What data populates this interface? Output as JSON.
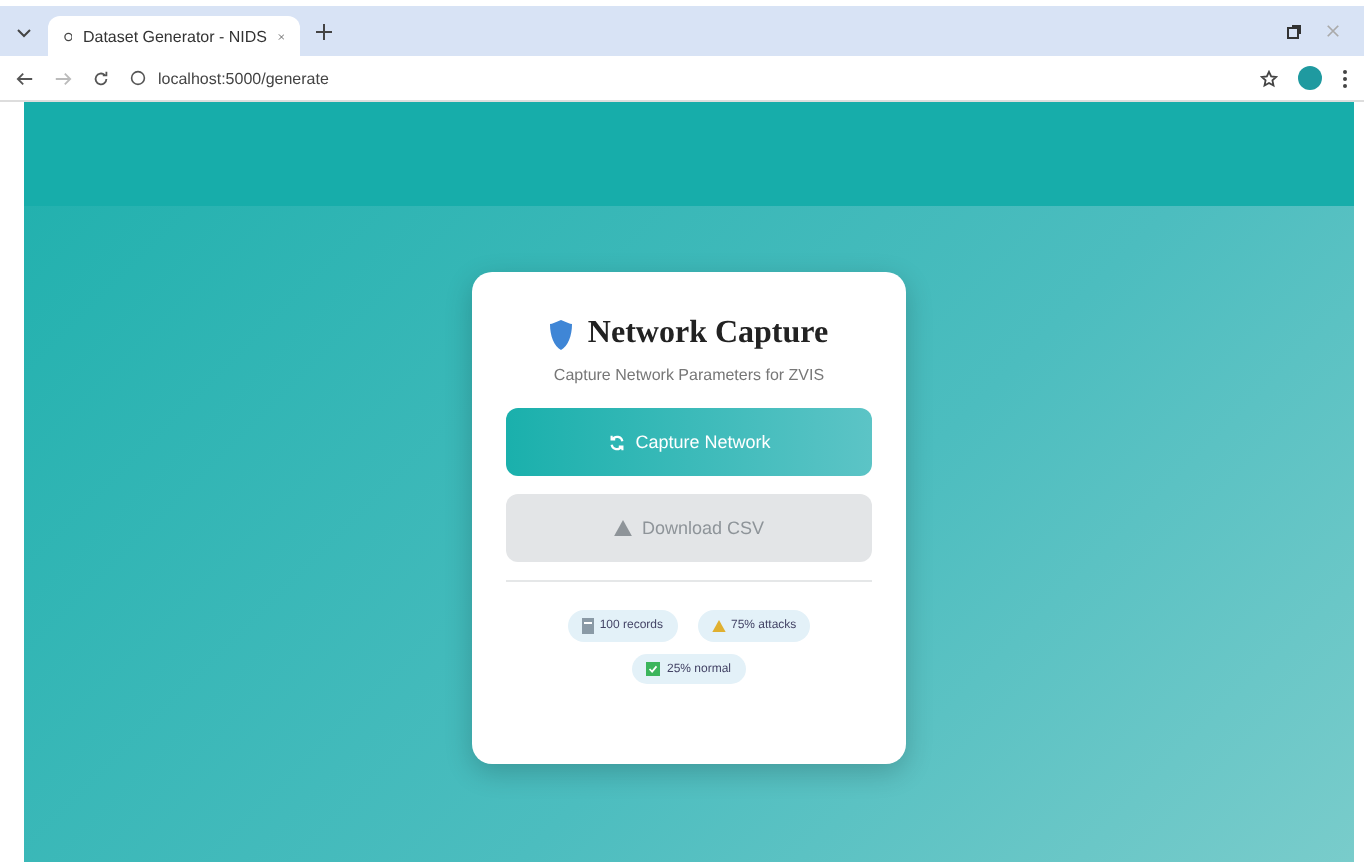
{
  "browser": {
    "tab_title": "Dataset Generator - NIDS",
    "url": "localhost:5000/generate"
  },
  "card": {
    "title": "Network Capture",
    "subtitle": "Capture Network Parameters for ZVIS",
    "buttons": [
      {
        "label": "Capture Network",
        "disabled": false
      },
      {
        "label": "Download CSV",
        "disabled": true
      }
    ],
    "badges": [
      {
        "kind": "records",
        "text": "100 records"
      },
      {
        "kind": "attacks",
        "text": "75% attacks"
      },
      {
        "kind": "normal",
        "text": "25% normal"
      }
    ]
  }
}
